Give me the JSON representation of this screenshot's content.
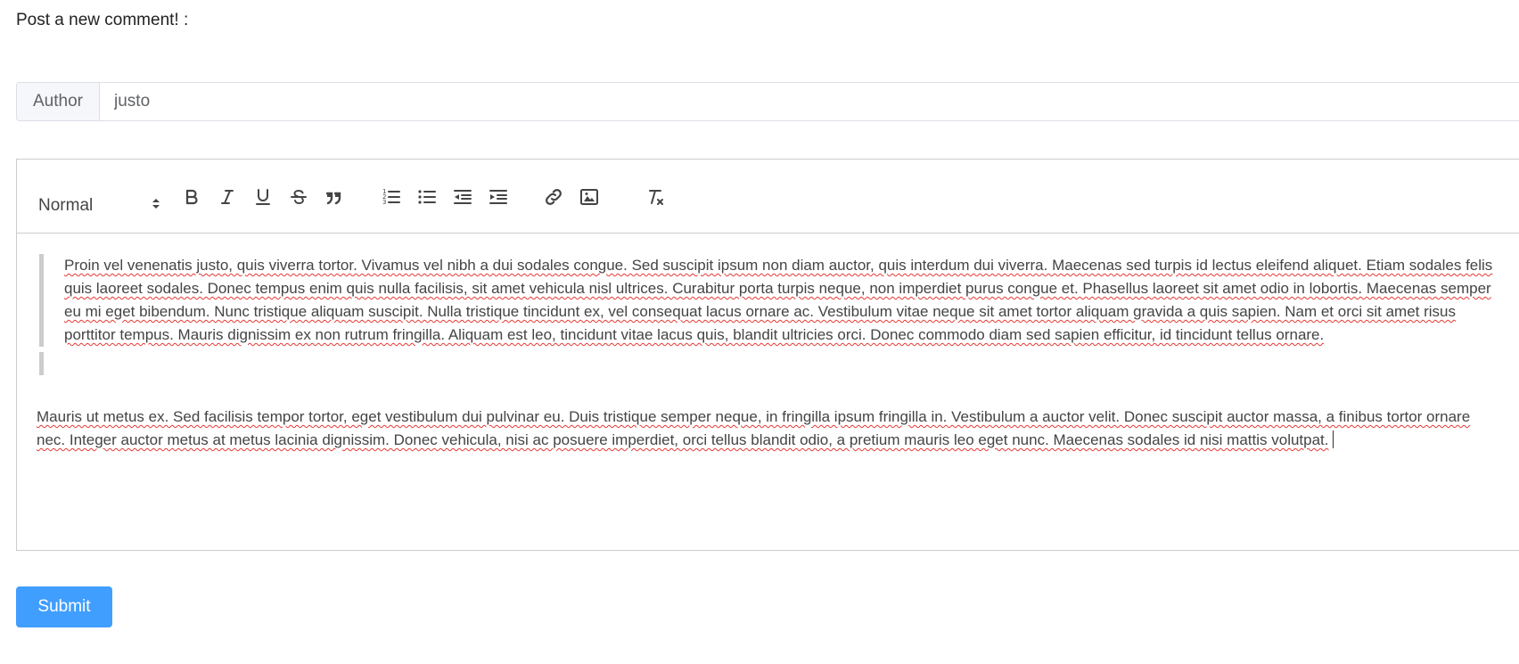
{
  "page": {
    "title": "Post a new comment! :"
  },
  "author": {
    "label": "Author",
    "value": "justo"
  },
  "editor": {
    "toolbar": {
      "header_select_value": "Normal",
      "icons": [
        "bold-icon",
        "italic-icon",
        "underline-icon",
        "strike-icon",
        "blockquote-icon",
        "ordered-list-icon",
        "bullet-list-icon",
        "outdent-icon",
        "indent-icon",
        "link-icon",
        "image-icon",
        "clean-format-icon"
      ]
    },
    "blockquote_text": "Proin vel venenatis justo, quis viverra tortor. Vivamus vel nibh a dui sodales congue. Sed suscipit ipsum non diam auctor, quis interdum dui viverra. Maecenas sed turpis id lectus eleifend aliquet. Etiam sodales felis quis laoreet sodales. Donec tempus enim quis nulla facilisis, sit amet vehicula nisl ultrices. Curabitur porta turpis neque, non imperdiet purus congue et. Phasellus laoreet sit amet odio in lobortis. Maecenas semper eu mi eget bibendum. Nunc tristique aliquam suscipit. Nulla tristique tincidunt ex, vel consequat lacus ornare ac. Vestibulum vitae neque sit amet tortor aliquam gravida a quis sapien. Nam et orci sit amet risus porttitor tempus. Mauris dignissim ex non rutrum fringilla. Aliquam est leo, tincidunt vitae lacus quis, blandit ultricies orci. Donec commodo diam sed sapien efficitur, id tincidunt tellus ornare.",
    "paragraph_text": "Mauris ut metus ex. Sed facilisis tempor tortor, eget vestibulum dui pulvinar eu. Duis tristique semper neque, in fringilla ipsum fringilla in. Vestibulum a auctor velit. Donec suscipit auctor massa, a finibus tortor ornare nec. Integer auctor metus at metus lacinia dignissim. Donec vehicula, nisi ac posuere imperdiet, orci tellus blandit odio, a pretium mauris leo eget nunc. Maecenas sodales id nisi mattis volutpat.",
    "spellcheck_color": "#e53935"
  },
  "submit": {
    "label": "Submit",
    "color": "#409eff"
  }
}
